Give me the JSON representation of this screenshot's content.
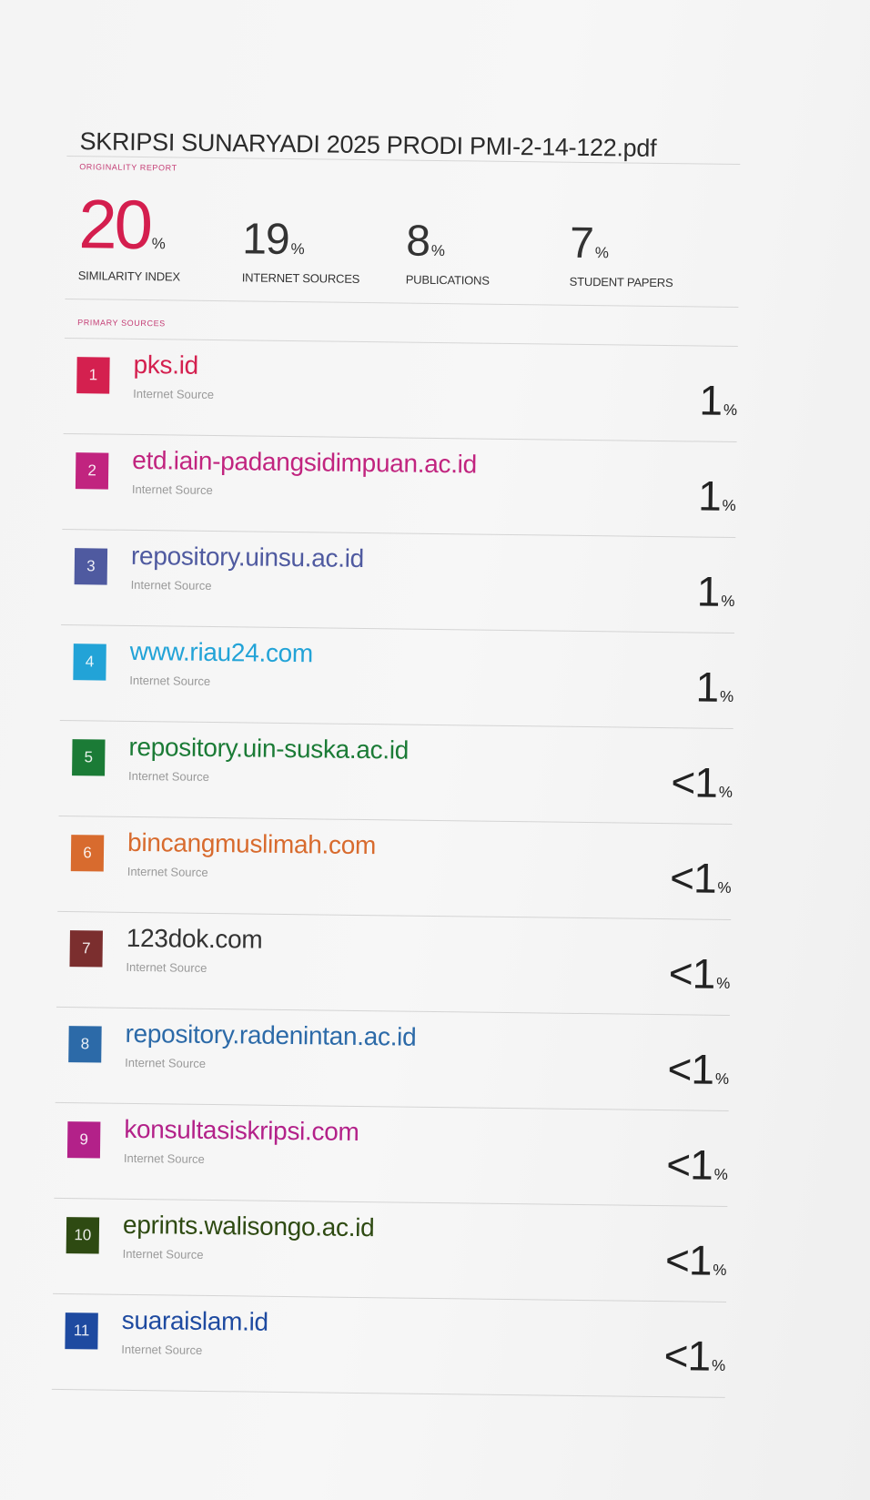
{
  "report": {
    "title": "SKRIPSI SUNARYADI 2025 PRODI PMI-2-14-122.pdf",
    "section_label": "ORIGINALITY REPORT",
    "primary_label": "PRIMARY SOURCES",
    "percent_sign": "%",
    "stats": [
      {
        "value": "20",
        "label": "SIMILARITY INDEX"
      },
      {
        "value": "19",
        "label": "INTERNET SOURCES"
      },
      {
        "value": "8",
        "label": "PUBLICATIONS"
      },
      {
        "value": "7",
        "label": "STUDENT PAPERS"
      }
    ]
  },
  "sources": [
    {
      "rank": "1",
      "name": "pks.id",
      "type": "Internet Source",
      "percent": "1",
      "color": "#d4204f"
    },
    {
      "rank": "2",
      "name": "etd.iain-padangsidimpuan.ac.id",
      "type": "Internet Source",
      "percent": "1",
      "color": "#c1247f"
    },
    {
      "rank": "3",
      "name": "repository.uinsu.ac.id",
      "type": "Internet Source",
      "percent": "1",
      "color": "#4f5aa0"
    },
    {
      "rank": "4",
      "name": "www.riau24.com",
      "type": "Internet Source",
      "percent": "1",
      "color": "#22a3d7"
    },
    {
      "rank": "5",
      "name": "repository.uin-suska.ac.id",
      "type": "Internet Source",
      "percent": "<1",
      "color": "#1b7b36"
    },
    {
      "rank": "6",
      "name": "bincangmuslimah.com",
      "type": "Internet Source",
      "percent": "<1",
      "color": "#d86b2e"
    },
    {
      "rank": "7",
      "name": "123dok.com",
      "type": "Internet Source",
      "percent": "<1",
      "color": "#7b2e2e"
    },
    {
      "rank": "8",
      "name": "repository.radenintan.ac.id",
      "type": "Internet Source",
      "percent": "<1",
      "color": "#2c6aa8"
    },
    {
      "rank": "9",
      "name": "konsultasiskripsi.com",
      "type": "Internet Source",
      "percent": "<1",
      "color": "#b32189"
    },
    {
      "rank": "10",
      "name": "eprints.walisongo.ac.id",
      "type": "Internet Source",
      "percent": "<1",
      "color": "#2e4a12"
    },
    {
      "rank": "11",
      "name": "suaraislam.id",
      "type": "Internet Source",
      "percent": "<1",
      "color": "#1e4aa0"
    }
  ]
}
